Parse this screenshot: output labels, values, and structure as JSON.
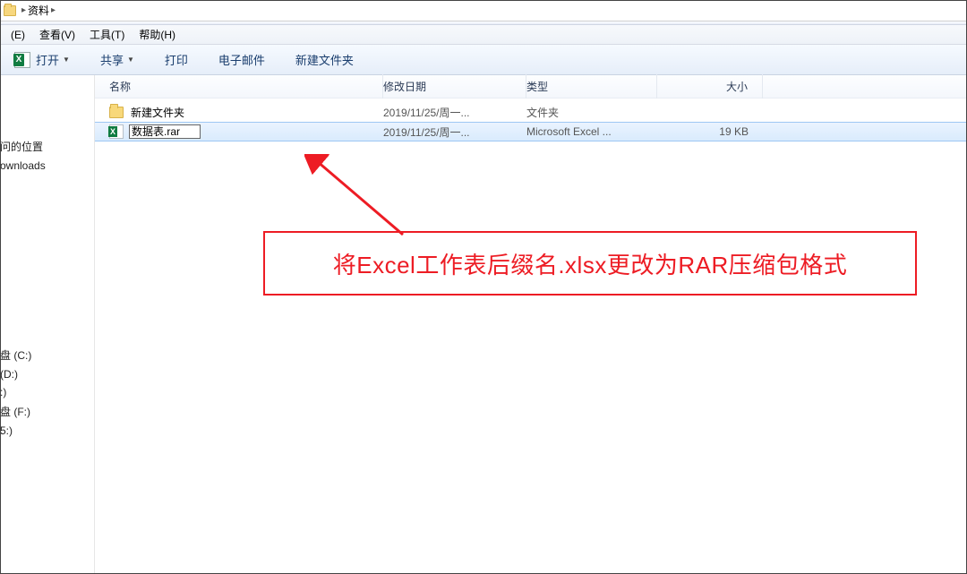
{
  "address": {
    "folder_label": "资料"
  },
  "menu": {
    "edit": "(E)",
    "view": "查看(V)",
    "tools": "工具(T)",
    "help": "帮助(H)"
  },
  "toolbar": {
    "open": "打开",
    "share": "共享",
    "print": "打印",
    "email": "电子邮件",
    "new_folder": "新建文件夹"
  },
  "columns": {
    "name": "名称",
    "date": "修改日期",
    "type": "类型",
    "size": "大小"
  },
  "rows": [
    {
      "name": "新建文件夹",
      "date": "2019/11/25/周一...",
      "type": "文件夹",
      "size": ""
    },
    {
      "name": "数据表.rar",
      "date": "2019/11/25/周一...",
      "type": "Microsoft Excel ...",
      "size": "19 KB"
    }
  ],
  "sidebar": {
    "group1": [
      "问的位置",
      "ownloads"
    ],
    "group2": [
      "盘 (C:)",
      "(D:)",
      ":)",
      "盘 (F:)",
      "5:)"
    ]
  },
  "annotation": {
    "text": "将Excel工作表后缀名.xlsx更改为RAR压缩包格式"
  }
}
